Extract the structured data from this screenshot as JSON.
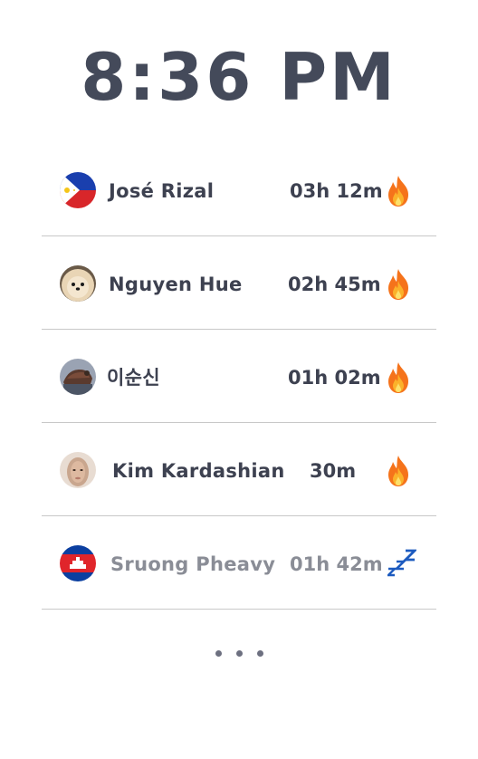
{
  "clock": {
    "time": "8:36 PM"
  },
  "users": [
    {
      "name": "José Rizal",
      "duration": "03h 12m",
      "status_icon": "fire-icon",
      "avatar": "philippines-flag",
      "active": true
    },
    {
      "name": "Nguyen Hue",
      "duration": "02h 45m",
      "status_icon": "fire-icon",
      "avatar": "pomeranian-dog-photo",
      "active": true
    },
    {
      "name": "이순신",
      "duration": "01h 02m",
      "status_icon": "fire-icon",
      "avatar": "turtle-ship-photo",
      "active": true
    },
    {
      "name": "Kim Kardashian",
      "duration": "30m",
      "status_icon": "fire-icon",
      "avatar": "portrait-photo",
      "active": true
    },
    {
      "name": "Sruong Pheavy",
      "duration": "01h 42m",
      "status_icon": "sleep-zzz-icon",
      "avatar": "cambodia-flag",
      "active": false
    }
  ],
  "more_indicator": "ellipsis-icon",
  "colors": {
    "text": "#3d4150",
    "inactive_text": "#8a8d96",
    "divider": "#c8c8c8",
    "sleep_blue": "#1d5bbf",
    "fire_orange": "#f5731b"
  }
}
